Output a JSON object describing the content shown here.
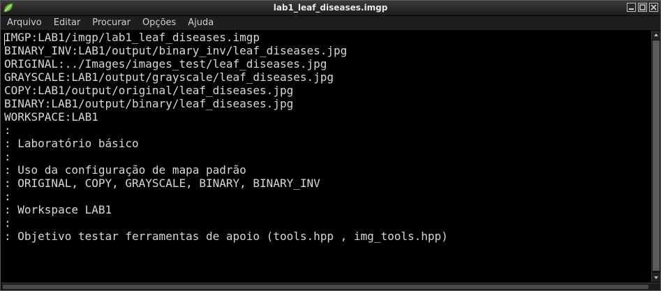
{
  "window": {
    "title": "lab1_leaf_diseases.imgp",
    "icon": "app-leaf-icon",
    "controls": [
      "minimize-icon",
      "maximize-icon",
      "close-icon"
    ]
  },
  "menu": {
    "items": [
      "Arquivo",
      "Editar",
      "Procurar",
      "Opções",
      "Ajuda"
    ]
  },
  "editor": {
    "lines": [
      "IMGP:LAB1/imgp/lab1_leaf_diseases.imgp",
      "BINARY_INV:LAB1/output/binary_inv/leaf_diseases.jpg",
      "ORIGINAL:../Images/images_test/leaf_diseases.jpg",
      "GRAYSCALE:LAB1/output/grayscale/leaf_diseases.jpg",
      "COPY:LAB1/output/original/leaf_diseases.jpg",
      "BINARY:LAB1/output/binary/leaf_diseases.jpg",
      "WORKSPACE:LAB1",
      ":",
      ": Laboratório básico",
      ":",
      ": Uso da configuração de mapa padrão",
      ": ORIGINAL, COPY, GRAYSCALE, BINARY, BINARY_INV",
      ":",
      ": Workspace LAB1",
      ":",
      ": Objetivo testar ferramentas de apoio (tools.hpp , img_tools.hpp)"
    ]
  },
  "colors": {
    "background": "#000000",
    "text": "#d8d8d8",
    "titlebar": "#2a2a2a",
    "icon_green": "#6fbf3a"
  }
}
